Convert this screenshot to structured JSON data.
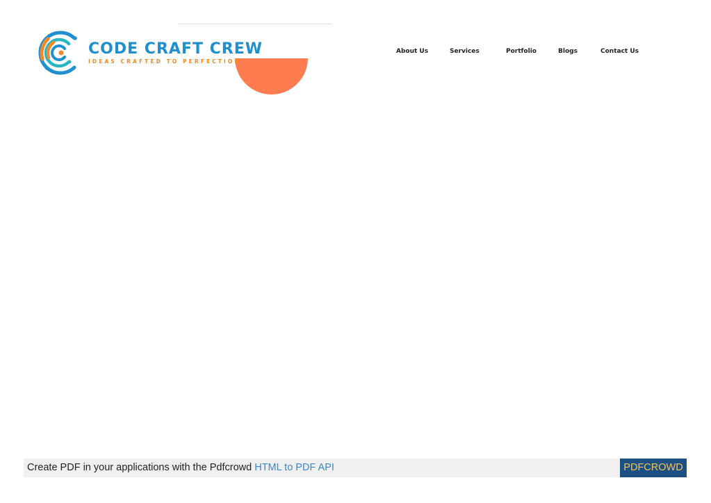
{
  "header": {
    "logo": {
      "title": "CODE CRAFT CREW",
      "tagline": "IDEAS CRAFTED TO PERFECTION",
      "icon": "concentric-c-logo-icon"
    },
    "nav": {
      "items": [
        {
          "label": "About Us"
        },
        {
          "label": "Services"
        },
        {
          "label": "Portfolio"
        },
        {
          "label": "Blogs"
        },
        {
          "label": "Contact Us"
        }
      ]
    }
  },
  "footer": {
    "text": "Create PDF in your applications with the Pdfcrowd ",
    "link_label": "HTML to PDF API",
    "button_label": "PDFCROWD"
  },
  "colors": {
    "brand_blue": "#1f8fcf",
    "brand_orange": "#f28a2b",
    "accent_coral": "#ff7b50",
    "footer_button_bg": "#1e4f83",
    "footer_button_text": "#f0c65a",
    "footer_link": "#3a87c8"
  }
}
